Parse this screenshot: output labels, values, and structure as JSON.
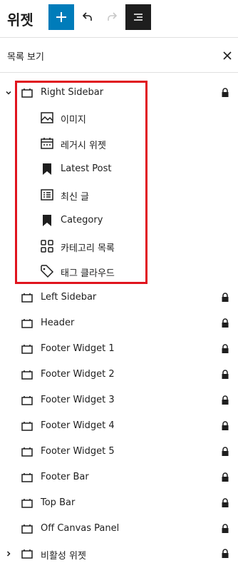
{
  "header": {
    "title": "위젯",
    "add_icon": "plus-icon",
    "undo_icon": "undo-icon",
    "redo_icon": "redo-icon",
    "list_view_icon": "list-view-icon"
  },
  "panel": {
    "title": "목록 보기",
    "close_icon": "close-icon"
  },
  "colors": {
    "accent": "#007cba",
    "dark": "#1e1e1e",
    "highlight": "#e0141e"
  },
  "tree": {
    "right_sidebar": "Right Sidebar",
    "children": [
      {
        "label": "이미지",
        "icon": "image-icon"
      },
      {
        "label": "레거시 위젯",
        "icon": "calendar-icon"
      },
      {
        "label": "Latest Post",
        "icon": "bookmark-icon"
      },
      {
        "label": "최신 글",
        "icon": "post-list-icon"
      },
      {
        "label": "Category",
        "icon": "bookmark-icon"
      },
      {
        "label": "카테고리 목록",
        "icon": "categories-icon"
      },
      {
        "label": "태그 클라우드",
        "icon": "tag-icon"
      }
    ],
    "areas": [
      "Left Sidebar",
      "Header",
      "Footer Widget 1",
      "Footer Widget 2",
      "Footer Widget 3",
      "Footer Widget 4",
      "Footer Widget 5",
      "Footer Bar",
      "Top Bar",
      "Off Canvas Panel"
    ],
    "inactive": "비활성 위젯"
  }
}
